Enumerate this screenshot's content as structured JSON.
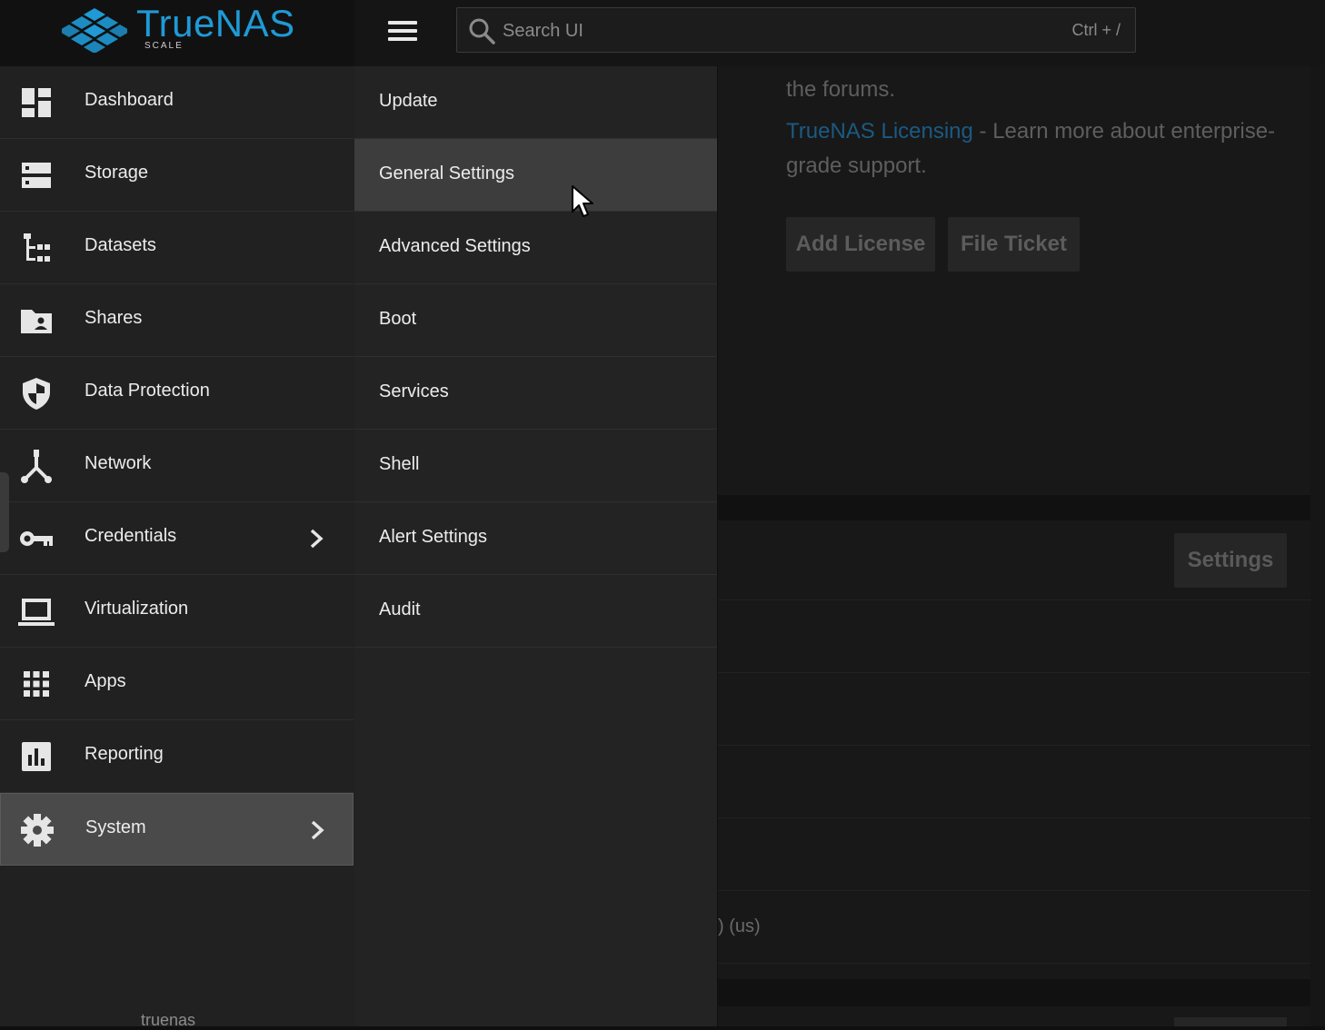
{
  "brand": {
    "name": "TrueNAS",
    "edition": "SCALE"
  },
  "search": {
    "placeholder": "Search UI",
    "shortcut": "Ctrl + /"
  },
  "sidebar": {
    "items": [
      {
        "label": "Dashboard",
        "icon": "dashboard-icon"
      },
      {
        "label": "Storage",
        "icon": "storage-icon"
      },
      {
        "label": "Datasets",
        "icon": "datasets-icon"
      },
      {
        "label": "Shares",
        "icon": "shares-folder-icon"
      },
      {
        "label": "Data Protection",
        "icon": "shield-icon"
      },
      {
        "label": "Network",
        "icon": "network-icon"
      },
      {
        "label": "Credentials",
        "icon": "key-icon"
      },
      {
        "label": "Virtualization",
        "icon": "laptop-icon"
      },
      {
        "label": "Apps",
        "icon": "apps-grid-icon"
      },
      {
        "label": "Reporting",
        "icon": "reporting-chart-icon"
      },
      {
        "label": "System",
        "icon": "gear-icon"
      }
    ],
    "footer": "truenas",
    "active_index": 10
  },
  "submenu": {
    "items": [
      {
        "label": "Update"
      },
      {
        "label": "General Settings"
      },
      {
        "label": "Advanced Settings"
      },
      {
        "label": "Boot"
      },
      {
        "label": "Services"
      },
      {
        "label": "Shell"
      },
      {
        "label": "Alert Settings"
      },
      {
        "label": "Audit"
      }
    ],
    "hovered_index": 1
  },
  "background": {
    "forums_text": "the forums.",
    "licensing_link": "TrueNAS Licensing",
    "licensing_text_1": " - Learn more about enterprise-",
    "licensing_text_2": "grade support.",
    "add_license_button": "Add License",
    "file_ticket_button": "File Ticket",
    "settings_button": "Settings",
    "partial_text": ") (us)"
  },
  "colors": {
    "brand": "#1f9ad6",
    "sidebar_bg": "#212121",
    "submenu_bg": "#232323",
    "active": "#4a4a4a"
  }
}
